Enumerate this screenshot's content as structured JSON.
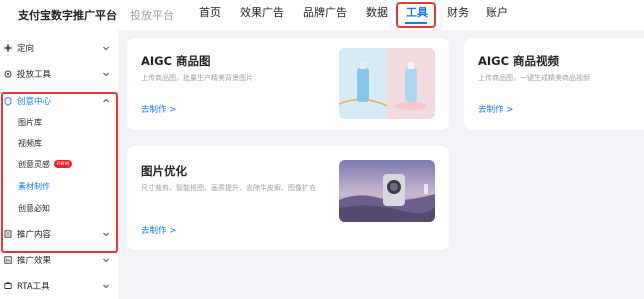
{
  "header": {
    "brand": "支付宝数字推广平台",
    "platform": "投放平台",
    "nav": [
      {
        "label": "首页",
        "active": false
      },
      {
        "label": "效果广告",
        "active": false
      },
      {
        "label": "品牌广告",
        "active": false
      },
      {
        "label": "数据",
        "active": false
      },
      {
        "label": "工具",
        "active": true
      },
      {
        "label": "财务",
        "active": false
      },
      {
        "label": "账户",
        "active": false
      }
    ]
  },
  "sidebar": {
    "items": [
      {
        "label": "定向",
        "icon": "target-icon",
        "expanded": false
      },
      {
        "label": "投放工具",
        "icon": "tools-icon",
        "expanded": false
      },
      {
        "label": "创意中心",
        "icon": "shield-icon",
        "expanded": true,
        "active": true
      },
      {
        "label": "推广内容",
        "icon": "content-icon",
        "expanded": false
      },
      {
        "label": "推广效果",
        "icon": "chart-icon",
        "expanded": false
      },
      {
        "label": "RTA工具",
        "icon": "rta-icon",
        "expanded": false
      }
    ],
    "creative_sub": [
      {
        "label": "图片库",
        "active": false
      },
      {
        "label": "视频库",
        "active": false
      },
      {
        "label": "创意灵感",
        "active": false,
        "badge": "new"
      },
      {
        "label": "素材制作",
        "active": true
      },
      {
        "label": "创意必知",
        "active": false
      }
    ]
  },
  "cards": [
    {
      "title": "AIGC 商品图",
      "desc": "上传商品图，批量生产精美背景图片",
      "link": "去制作 >"
    },
    {
      "title": "AIGC 商品视频",
      "desc": "上传商品图，一键生成精美商品视频",
      "link": "去制作 >"
    },
    {
      "title": "图片优化",
      "desc": "尺寸裁剪、智能抠图、画质提升、去除牛皮癣、图像扩充",
      "link": "去制作 >"
    }
  ],
  "colors": {
    "accent": "#1677ff",
    "highlight": "#e53935",
    "badge": "#f5222d"
  }
}
